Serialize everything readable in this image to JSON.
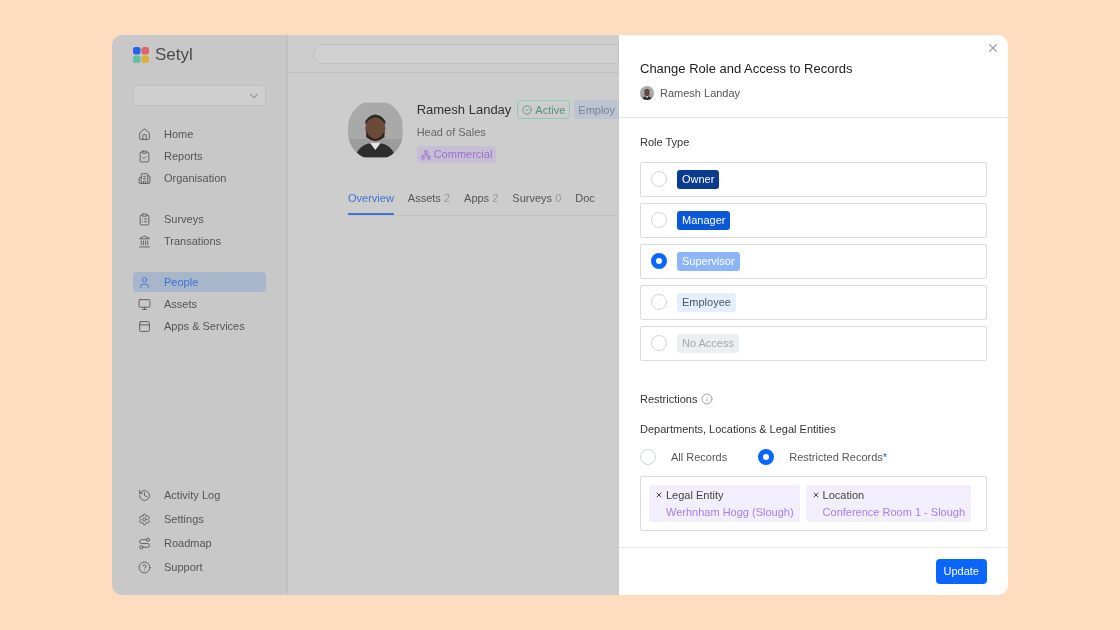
{
  "sidebar": {
    "logo": "Setyl",
    "nav_groups": [
      [
        {
          "label": "Home",
          "selected": false
        },
        {
          "label": "Reports",
          "selected": false
        },
        {
          "label": "Organisation",
          "selected": false
        }
      ],
      [
        {
          "label": "Surveys",
          "selected": false
        },
        {
          "label": "Transations",
          "selected": false
        }
      ],
      [
        {
          "label": "People",
          "selected": true
        },
        {
          "label": "Assets",
          "selected": false
        },
        {
          "label": "Apps & Services",
          "selected": false
        }
      ]
    ],
    "bottom_items": [
      {
        "label": "Activity Log"
      },
      {
        "label": "Settings"
      },
      {
        "label": "Roadmap"
      },
      {
        "label": "Support"
      }
    ]
  },
  "profile": {
    "name": "Ramesh Landay",
    "status": "Active",
    "badge": "Employ",
    "title": "Head of Sales",
    "department": "Commercial",
    "tabs": [
      {
        "label": "Overview",
        "selected": true
      },
      {
        "label": "Assets",
        "count": "2",
        "selected": false
      },
      {
        "label": "Apps",
        "count": "2",
        "selected": false
      },
      {
        "label": "Surveys",
        "count": "0",
        "selected": false
      },
      {
        "label": "Doc",
        "selected": false
      }
    ]
  },
  "drawer": {
    "title": "Change Role and Access to Records",
    "person": "Ramesh Landay",
    "role_heading": "Role Type",
    "roles": [
      {
        "label": "Owner",
        "kind": "dark",
        "selected": false
      },
      {
        "label": "Manager",
        "kind": "primary",
        "selected": false
      },
      {
        "label": "Supervisor",
        "kind": "light",
        "selected": true
      },
      {
        "label": "Employee",
        "kind": "pale",
        "selected": false
      },
      {
        "label": "No Access",
        "kind": "muted",
        "selected": false
      }
    ],
    "restrictions_heading": "Restrictions",
    "scope_heading": "Departments, Locations & Legal Entities",
    "scopes": [
      {
        "label": "All Records",
        "selected": false
      },
      {
        "label": "Restricted Records",
        "required_mark": "*",
        "selected": true
      }
    ],
    "tags": [
      {
        "type": "Legal Entity",
        "value": "Werhnham Hogg (Slough)"
      },
      {
        "type": "Location",
        "value": "Conference Room 1 - Slough"
      }
    ],
    "submit": "Update"
  }
}
